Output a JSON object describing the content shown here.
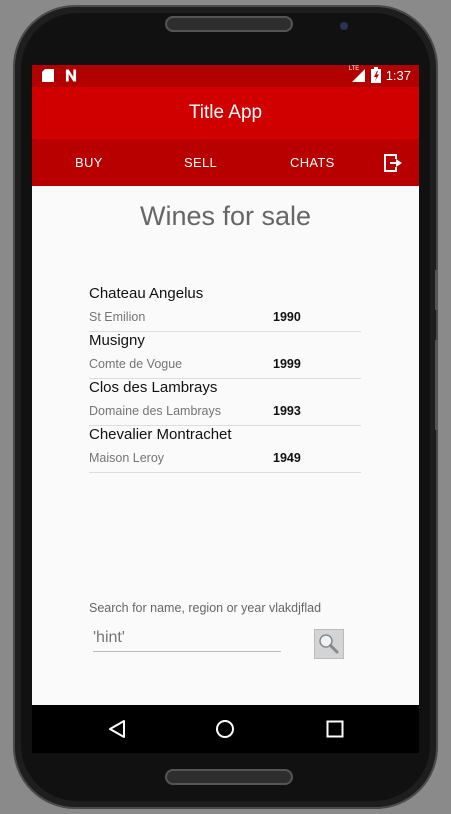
{
  "status_bar": {
    "time": "1:37",
    "network": "LTE",
    "left_icons": [
      "sd-card-icon",
      "n-notification-icon"
    ],
    "right_icons": [
      "signal-icon",
      "battery-icon"
    ]
  },
  "app_bar": {
    "title": "Title App"
  },
  "tabs": [
    {
      "label": "BUY"
    },
    {
      "label": "SELL"
    },
    {
      "label": "CHATS"
    }
  ],
  "exit_icon": "exit-to-app-icon",
  "main": {
    "heading": "Wines for sale",
    "wines": [
      {
        "name": "Chateau Angelus",
        "region": "St Emilion",
        "year": "1990"
      },
      {
        "name": "Musigny",
        "region": "Comte de Vogue",
        "year": "1999"
      },
      {
        "name": "Clos des Lambrays",
        "region": "Domaine des Lambrays",
        "year": "1993"
      },
      {
        "name": "Chevalier Montrachet",
        "region": "Maison Leroy",
        "year": "1949"
      }
    ],
    "search": {
      "label": "Search for name, region or year vlakdjflad",
      "placeholder": "'hint'",
      "button_icon": "search-icon"
    }
  },
  "nav_bar": {
    "icons": [
      "back-icon",
      "home-icon",
      "recents-icon"
    ]
  },
  "colors": {
    "status_bar": "#b00000",
    "app_bar": "#d00000",
    "tab_bar": "#b80000",
    "background": "#fafafa"
  }
}
